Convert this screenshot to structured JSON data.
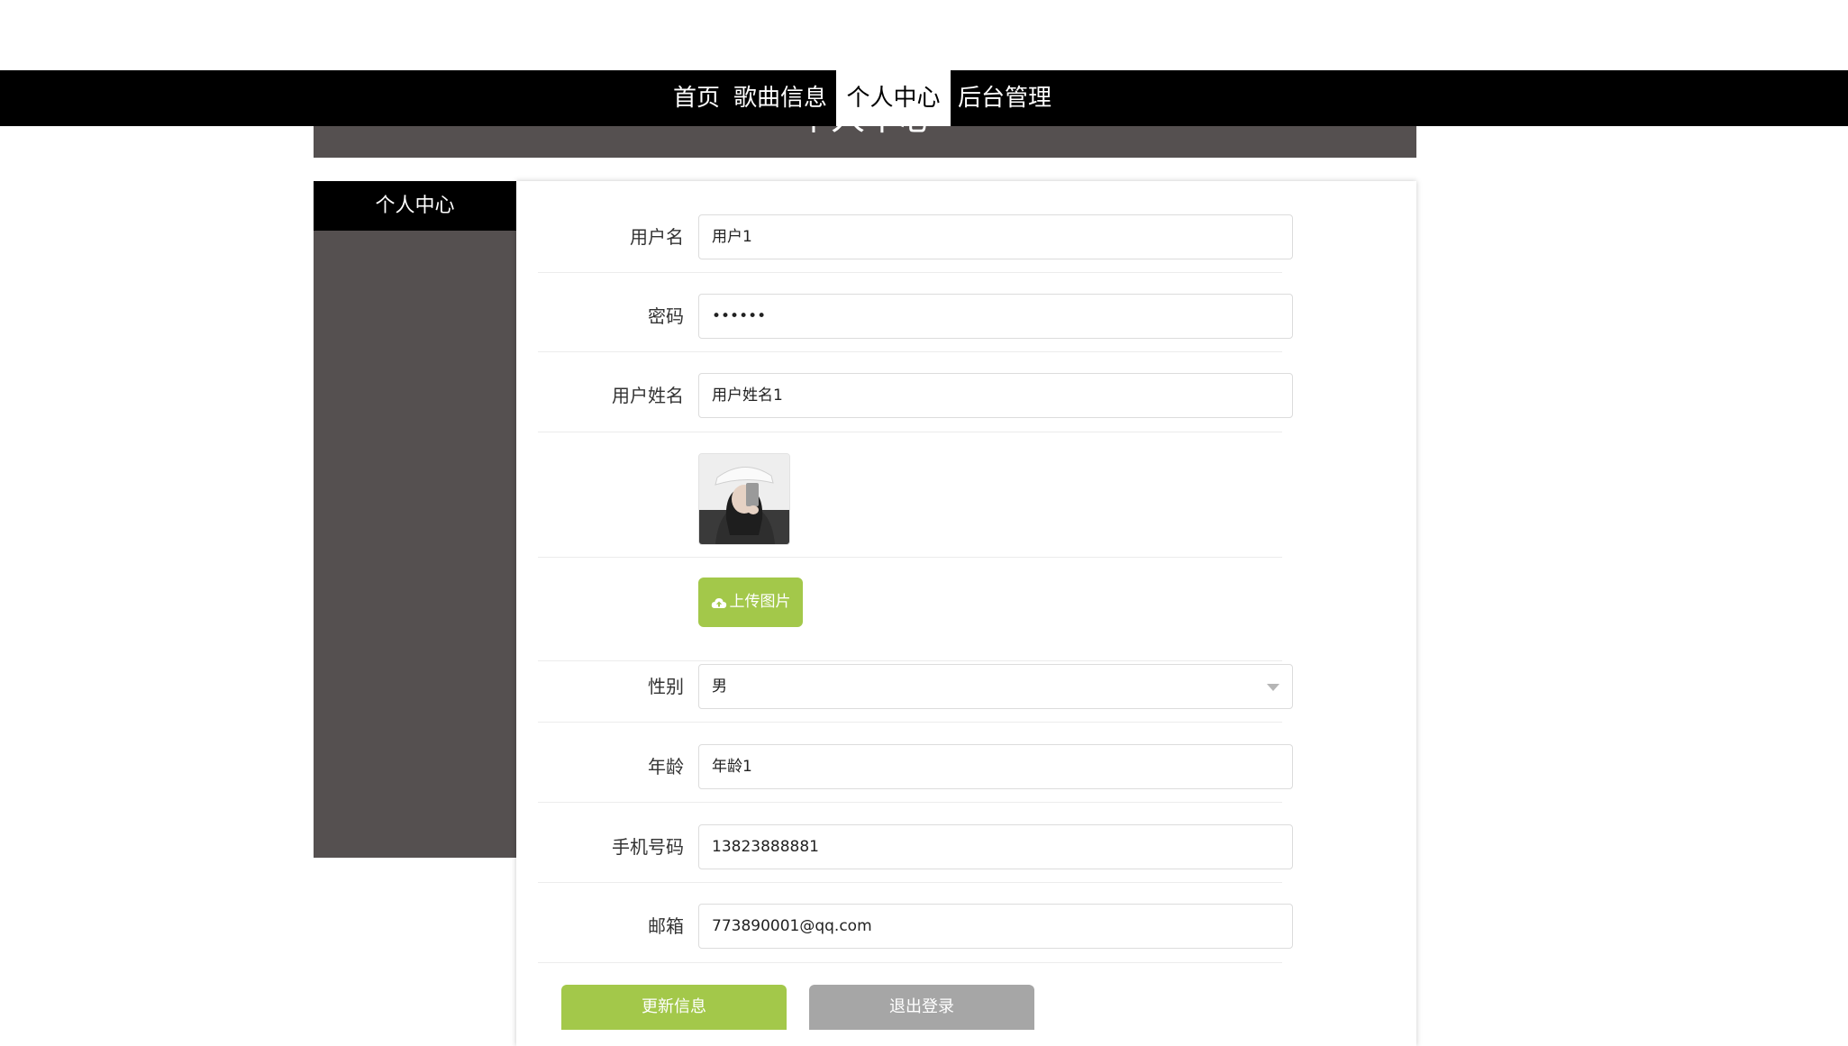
{
  "nav": {
    "items": [
      {
        "label": "首页"
      },
      {
        "label": "歌曲信息"
      },
      {
        "label": "个人中心"
      },
      {
        "label": "后台管理"
      }
    ]
  },
  "banner": {
    "title": "个人中心"
  },
  "sidebar": {
    "title": "个人中心"
  },
  "form": {
    "username": {
      "label": "用户名",
      "value": "用户1"
    },
    "password": {
      "label": "密码",
      "value": "••••••"
    },
    "realname": {
      "label": "用户姓名",
      "value": "用户姓名1"
    },
    "upload": {
      "label": "上传图片",
      "icon": "cloud-upload-icon"
    },
    "gender": {
      "label": "性别",
      "value": "男"
    },
    "age": {
      "label": "年龄",
      "value": "年龄1"
    },
    "phone": {
      "label": "手机号码",
      "value": "13823888881"
    },
    "email": {
      "label": "邮箱",
      "value": "773890001@qq.com"
    }
  },
  "actions": {
    "update_label": "更新信息",
    "logout_label": "退出登录"
  },
  "colors": {
    "nav_bg": "#000000",
    "sidebar_bg": "#555050",
    "accent_green": "#a3c84a",
    "logout_gray": "#a6a6a6"
  }
}
